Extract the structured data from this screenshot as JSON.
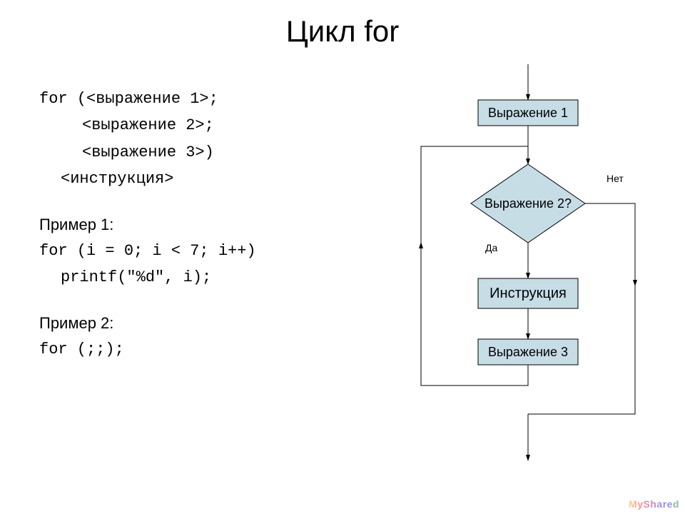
{
  "title": "Цикл for",
  "code": {
    "syntax_line1": "for (<выражение 1>;",
    "syntax_line2": "<выражение 2>;",
    "syntax_line3": "<выражение 3>)",
    "syntax_line4": "<инструкция>",
    "ex1_label": "Пример 1:",
    "ex1_line1": "for (i = 0; i < 7; i++)",
    "ex1_line2": "printf(\"%d\", i);",
    "ex2_label": "Пример 2:",
    "ex2_line1": "for (;;);"
  },
  "flow": {
    "box1": "Выражение 1",
    "diamond": "Выражение 2?",
    "yes": "Да",
    "no": "Нет",
    "box_instr": "Инструкция",
    "box3": "Выражение 3"
  },
  "watermark": "MyShared"
}
